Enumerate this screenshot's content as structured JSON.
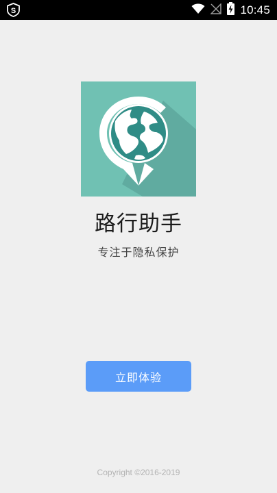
{
  "status_bar": {
    "time": "10:45",
    "icons": [
      "shield-s-icon",
      "wifi-icon",
      "signal-off-icon",
      "battery-charging-icon"
    ]
  },
  "app": {
    "name": "路行助手",
    "tagline": "专注于隐私保护",
    "icon": "globe-pin-icon"
  },
  "actions": {
    "start_label": "立即体验"
  },
  "footer": {
    "copyright": "Copyright ©2016-2019"
  },
  "colors": {
    "background": "#efefef",
    "icon_teal": "#70c1b3",
    "icon_dark_teal": "#2f8c86",
    "button_blue": "#5b9cf8",
    "status_bar": "#000000"
  }
}
